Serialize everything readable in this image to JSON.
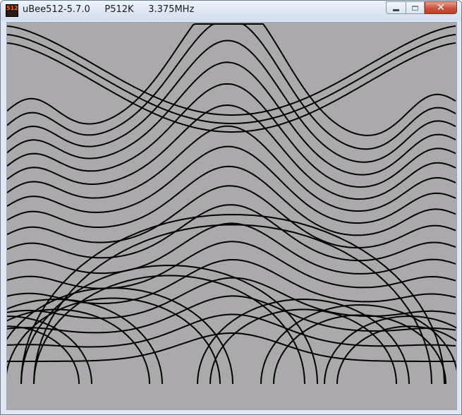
{
  "window": {
    "title": "uBee512-5.7.0     P512K     3.375MHz",
    "icon_label": "512",
    "controls": {
      "minimize": "minimize-icon",
      "maximize": "maximize-icon",
      "close": "close-icon"
    }
  },
  "display": {
    "background": "#aca9ad",
    "line_color": "#000000",
    "content": "wave-line-pattern"
  }
}
